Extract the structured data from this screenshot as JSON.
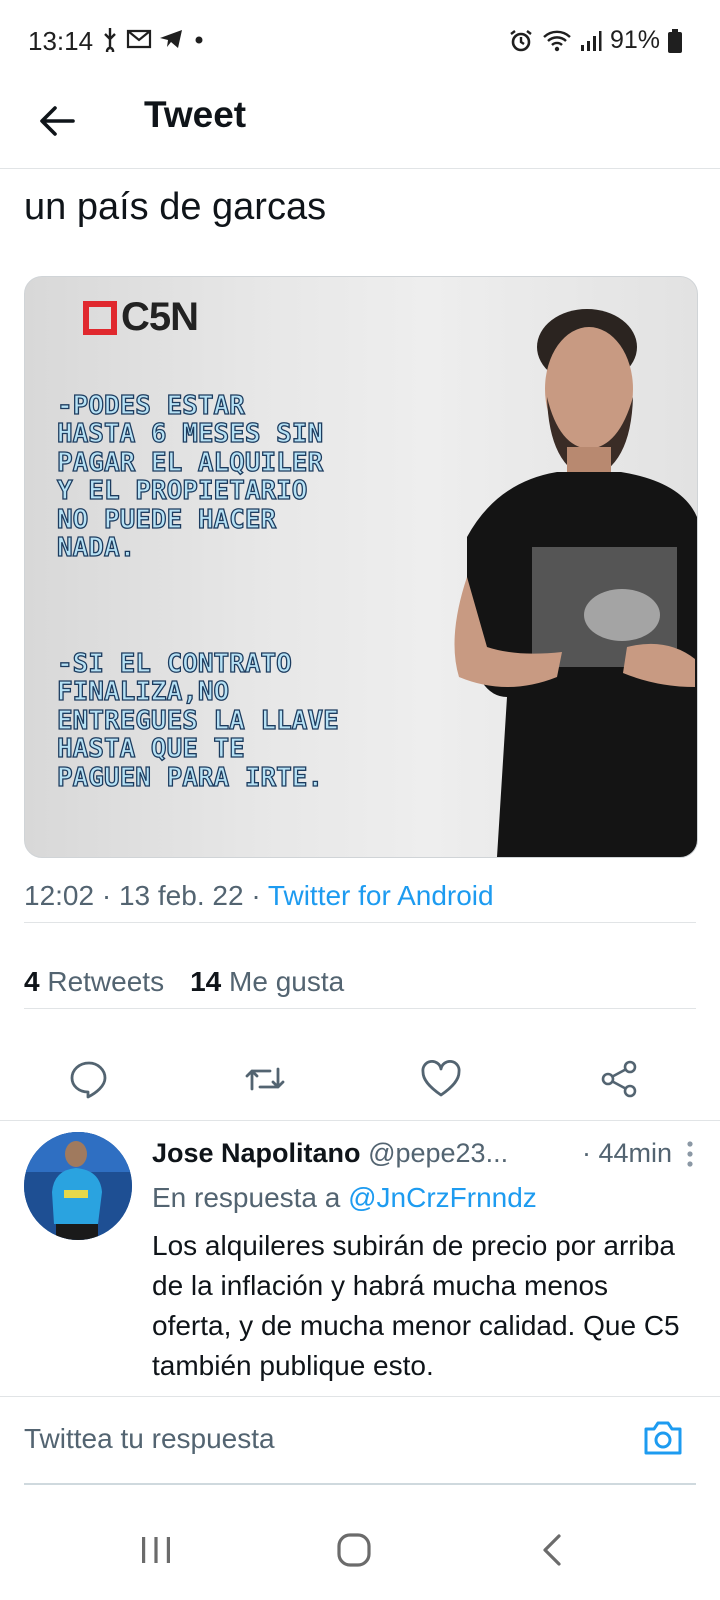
{
  "status_bar": {
    "time": "13:14",
    "battery": "91%",
    "icons": [
      "usb-icon",
      "gmail-icon",
      "telegram-icon",
      "dot-icon",
      "alarm-icon",
      "wifi-icon",
      "signal-icon",
      "battery-icon"
    ]
  },
  "app_bar": {
    "title": "Tweet"
  },
  "tweet": {
    "text": "un país de garcas",
    "media": {
      "logo": "C5N",
      "lines_1": "-PODES ESTAR\nHASTA 6 MESES SIN\nPAGAR EL ALQUILER\nY EL PROPIETARIO\nNO PUEDE HACER\nNADA.",
      "lines_2": "-SI EL CONTRATO\nFINALIZA,NO\nENTREGUES LA LLAVE\nHASTA QUE TE\nPAGUEN PARA IRTE."
    },
    "time": "12:02",
    "date": "13 feb. 22",
    "source": "Twitter for Android",
    "retweets_count": "4",
    "retweets_label": "Retweets",
    "likes_count": "14",
    "likes_label": "Me gusta"
  },
  "reply": {
    "name": "Jose Napolitano",
    "handle": "@pepe23...",
    "time": "· 44min",
    "in_reply_label": "En respuesta a",
    "in_reply_mention": "@JnCrzFrnndz",
    "body": "Los alquileres subirán de precio por arriba de la inflación y habrá mucha menos oferta, y de mucha menor calidad. Que C5 también publique esto."
  },
  "compose": {
    "placeholder": "Twittea tu respuesta"
  },
  "colors": {
    "accent": "#1d9bf0",
    "secondary_text": "#536471",
    "c5n_red": "#e0282e"
  }
}
